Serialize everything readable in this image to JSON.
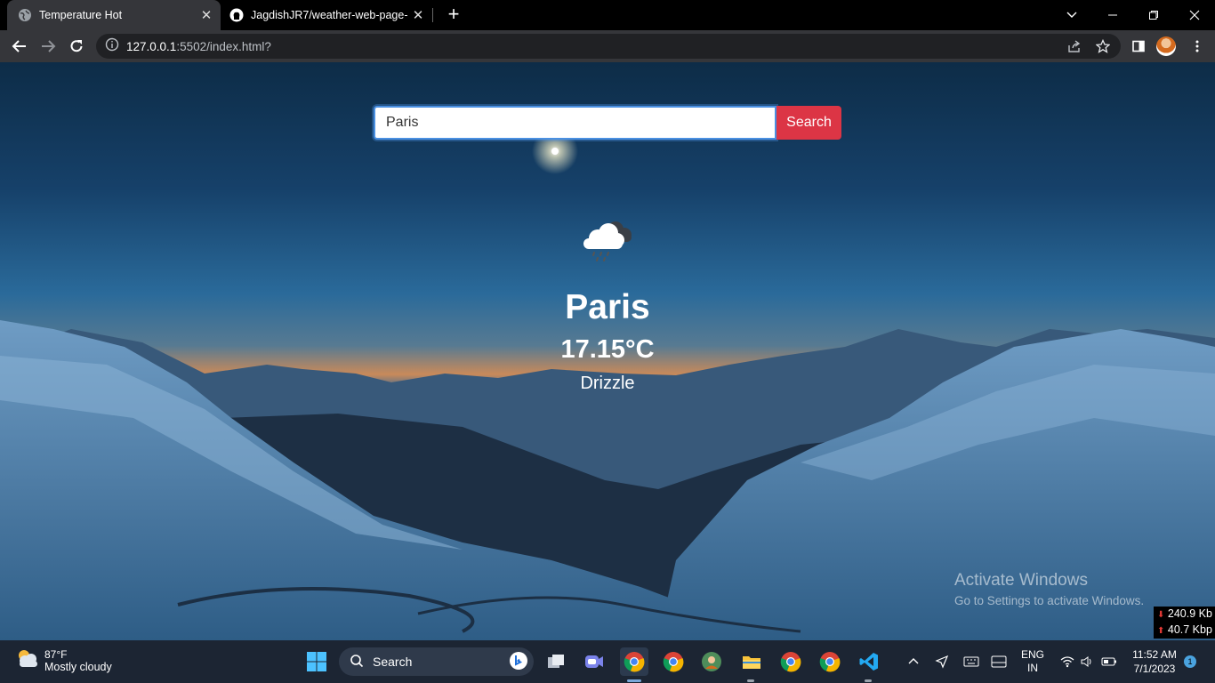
{
  "browser": {
    "tabs": [
      {
        "title": "Temperature Hot",
        "active": true
      },
      {
        "title": "JagdishJR7/weather-web-page-",
        "active": false
      }
    ],
    "address": {
      "host": "127.0.0.1",
      "rest": ":5502/index.html?"
    }
  },
  "page": {
    "search": {
      "value": "Paris",
      "button_label": "Search"
    },
    "weather": {
      "icon": "drizzle-cloud-icon",
      "city": "Paris",
      "temperature": "17.15°C",
      "description": "Drizzle"
    },
    "watermark": {
      "line1": "Activate Windows",
      "line2": "Go to Settings to activate Windows."
    }
  },
  "netspeed": {
    "down": "240.9 Kb",
    "up": "40.7 Kbp"
  },
  "taskbar": {
    "weather": {
      "temp": "87°F",
      "condition": "Mostly cloudy"
    },
    "search_label": "Search",
    "apps": [
      "start-icon",
      "search",
      "task-view-icon",
      "teams-icon",
      "chrome-icon",
      "chrome-icon",
      "chrome-profile-icon",
      "file-explorer-icon",
      "chrome-icon",
      "chrome-icon",
      "vscode-icon"
    ],
    "tray": {
      "lang1": "ENG",
      "lang2": "IN",
      "time": "11:52 AM",
      "date": "7/1/2023",
      "notifications": "1"
    }
  },
  "colors": {
    "search_button": "#dc3545",
    "input_border": "#4a90e2",
    "tab_active": "#35363a",
    "taskbar": "#1c2533"
  }
}
